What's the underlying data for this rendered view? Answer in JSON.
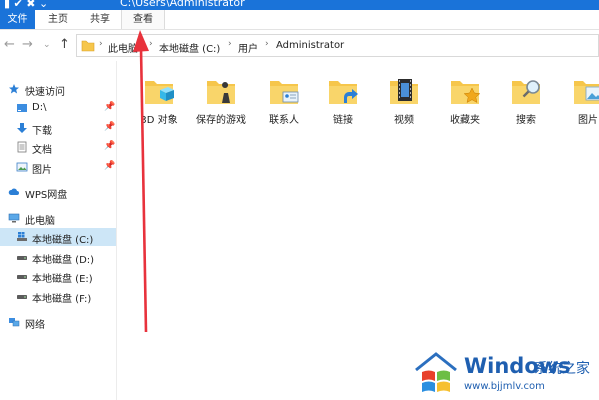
{
  "window": {
    "title": "C:\\Users\\Administrator"
  },
  "ribbon": {
    "tabs": [
      "文件",
      "主页",
      "共享",
      "查看"
    ]
  },
  "address": {
    "crumbs": [
      "此电脑",
      "本地磁盘 (C:)",
      "用户",
      "Administrator"
    ]
  },
  "sidebar": {
    "items": [
      {
        "label": "快速访问",
        "icon": "star-icon"
      },
      {
        "label": "D:\\",
        "icon": "drive-icon",
        "pinned": true
      },
      {
        "label": "下载",
        "icon": "download-icon",
        "pinned": true
      },
      {
        "label": "文档",
        "icon": "document-icon",
        "pinned": true
      },
      {
        "label": "图片",
        "icon": "picture-icon",
        "pinned": true
      },
      {
        "label": "WPS网盘",
        "icon": "cloud-icon"
      },
      {
        "label": "此电脑",
        "icon": "computer-icon"
      },
      {
        "label": "本地磁盘 (C:)",
        "icon": "windows-drive-icon",
        "selected": true
      },
      {
        "label": "本地磁盘 (D:)",
        "icon": "drive-icon"
      },
      {
        "label": "本地磁盘 (E:)",
        "icon": "drive-icon"
      },
      {
        "label": "本地磁盘 (F:)",
        "icon": "drive-icon"
      },
      {
        "label": "网络",
        "icon": "network-icon"
      }
    ]
  },
  "folders": [
    {
      "name": "3D 对象",
      "icon": "3d-objects-icon"
    },
    {
      "name": "保存的游戏",
      "icon": "saved-games-icon"
    },
    {
      "name": "联系人",
      "icon": "contacts-icon"
    },
    {
      "name": "链接",
      "icon": "links-icon"
    },
    {
      "name": "视频",
      "icon": "videos-icon"
    },
    {
      "name": "收藏夹",
      "icon": "favorites-icon"
    },
    {
      "name": "搜索",
      "icon": "search-icon"
    },
    {
      "name": "图片",
      "icon": "pictures-icon"
    }
  ],
  "watermark": {
    "brand": "Windows",
    "cn": "系统之家",
    "url": "www.bjjmlv.com"
  },
  "colors": {
    "accent": "#1a73d9",
    "selected": "#cde6f7",
    "annotation": "#e8323c",
    "folder": "#f6c64b"
  }
}
